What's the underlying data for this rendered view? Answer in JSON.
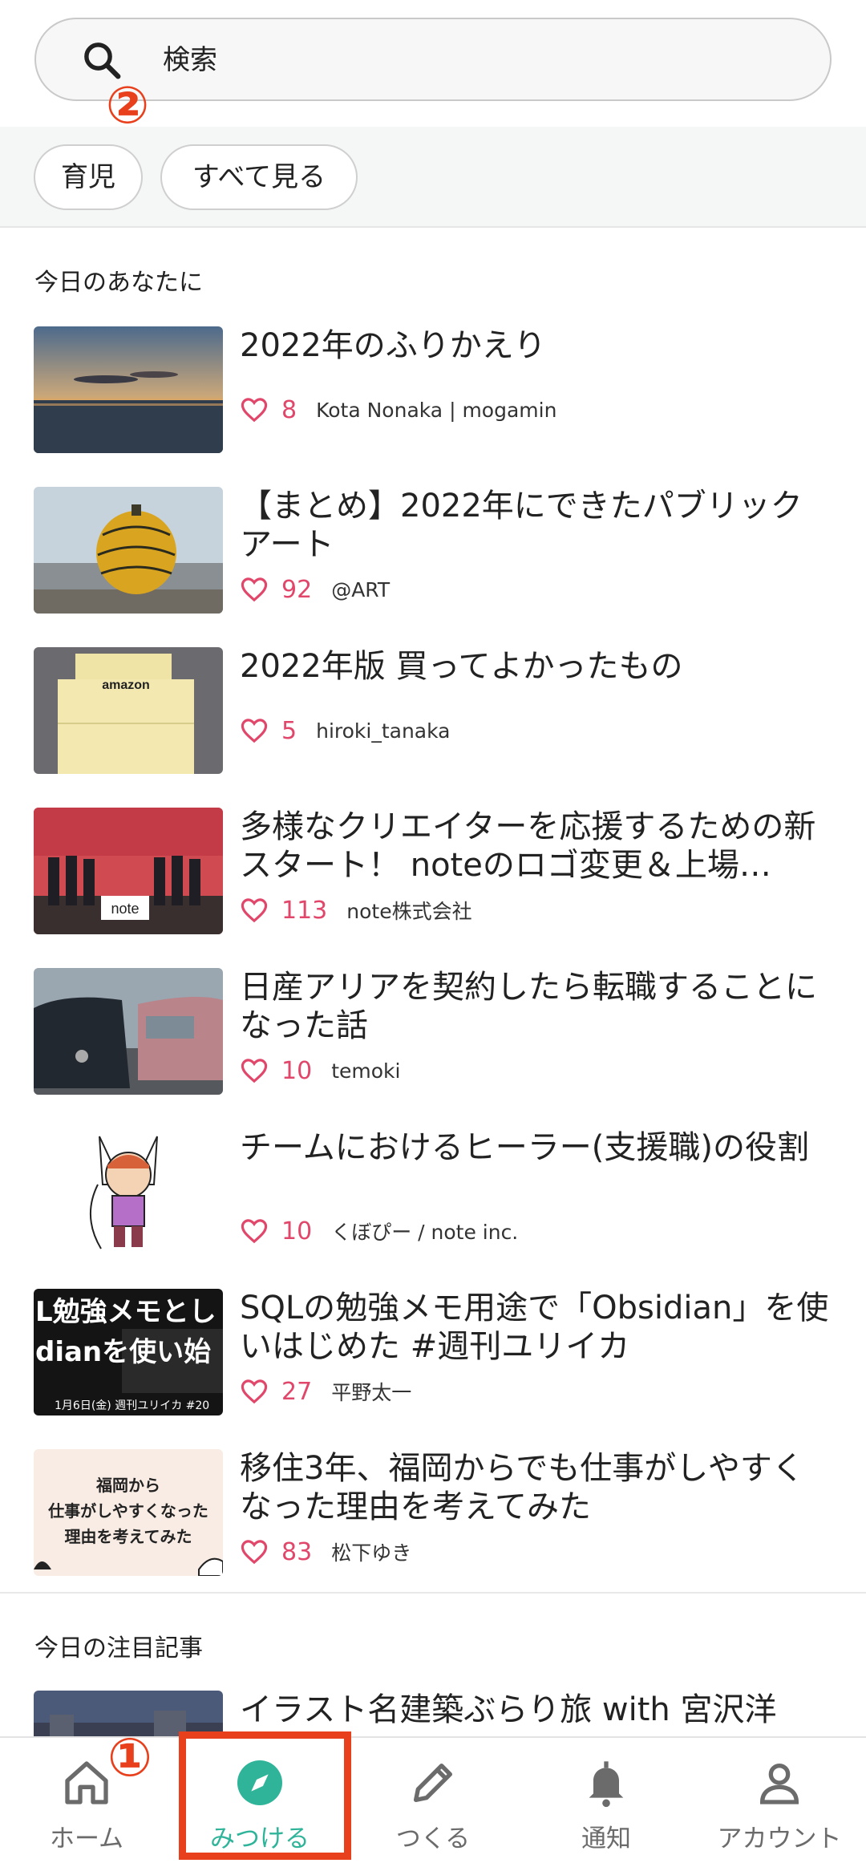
{
  "search": {
    "placeholder": "検索",
    "annotation": "②"
  },
  "chips": [
    "育児",
    "すべて見る"
  ],
  "section_today": "今日のあなたに",
  "articles": [
    {
      "title": "2022年のふりかえり",
      "likes": "8",
      "author": "Kota Nonaka | mogamin"
    },
    {
      "title": "【まとめ】2022年にできたパブリックアート",
      "likes": "92",
      "author": "@ART"
    },
    {
      "title": "2022年版 買ってよかったもの",
      "likes": "5",
      "author": "hiroki_tanaka"
    },
    {
      "title": "多様なクリエイターを応援するための新スタート！ noteのロゴ変更＆上場…",
      "likes": "113",
      "author": "note株式会社"
    },
    {
      "title": "日産アリアを契約したら転職することになった話",
      "likes": "10",
      "author": "temoki"
    },
    {
      "title": "チームにおけるヒーラー(支援職)の役割",
      "likes": "10",
      "author": "くぼぴー / note inc."
    },
    {
      "title": "SQLの勉強メモ用途で「Obsidian」を使いはじめた #週刊ユリイカ",
      "likes": "27",
      "author": "平野太一"
    },
    {
      "title": "移住3年、福岡からでも仕事がしやすくなった理由を考えてみた",
      "likes": "83",
      "author": "松下ゆき"
    }
  ],
  "section_featured": "今日の注目記事",
  "featured_article": {
    "title": "イラスト名建築ぶらり旅 with 宮沢洋"
  },
  "thumb_texts": {
    "amazon": "amazon",
    "note_logo": "note",
    "sql_line1": "L勉強メモとし",
    "sql_line2": "dianを使い始",
    "sql_line3": "1月6日(金) 週刊ユリイカ #20",
    "fukuoka_line1": "福岡から",
    "fukuoka_line2": "仕事がしやすくなった",
    "fukuoka_line3": "理由を考えてみた"
  },
  "nav": {
    "items": [
      {
        "label": "ホーム",
        "icon": "home-icon"
      },
      {
        "label": "みつける",
        "icon": "compass-icon"
      },
      {
        "label": "つくる",
        "icon": "pen-icon"
      },
      {
        "label": "通知",
        "icon": "bell-icon"
      },
      {
        "label": "アカウント",
        "icon": "person-icon"
      }
    ],
    "active": "みつける",
    "annotation": "①"
  },
  "colors": {
    "accent": "#2fb49a",
    "like": "#e0476a",
    "annotation": "#e8401c"
  }
}
